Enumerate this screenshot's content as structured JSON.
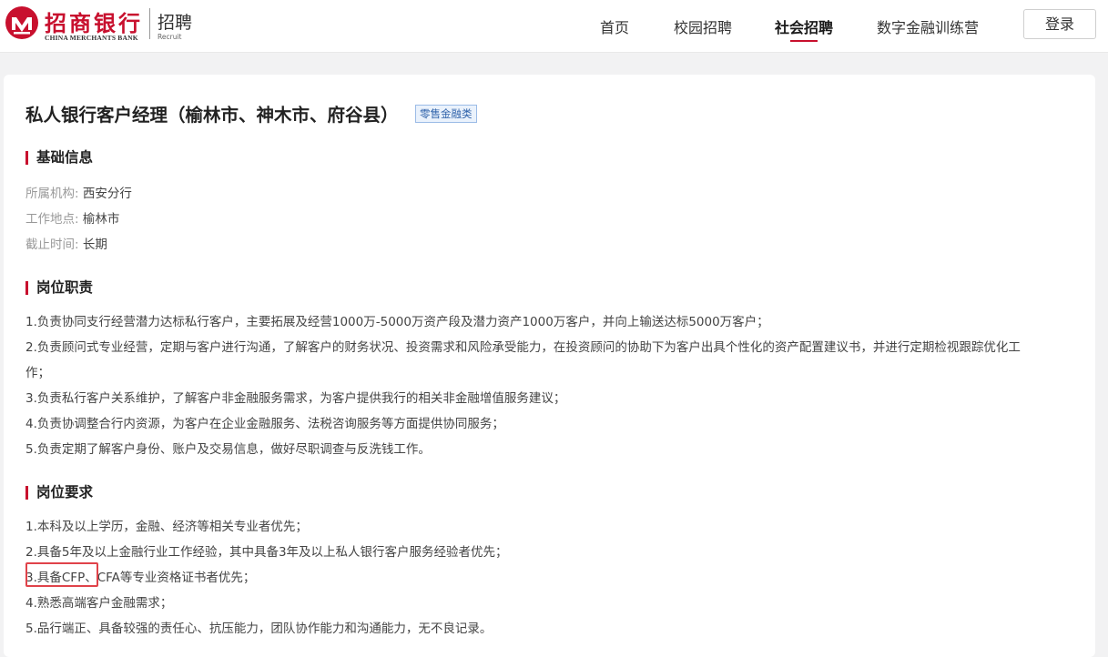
{
  "brand": {
    "name_cn": "招商银行",
    "name_en": "CHINA MERCHANTS BANK",
    "recruit_cn": "招聘",
    "recruit_en": "Recruit"
  },
  "nav": {
    "items": [
      {
        "label": "首页",
        "active": false
      },
      {
        "label": "校园招聘",
        "active": false
      },
      {
        "label": "社会招聘",
        "active": true
      },
      {
        "label": "数字金融训练营",
        "active": false
      }
    ],
    "login_label": "登录"
  },
  "job": {
    "title": "私人银行客户经理（榆林市、神木市、府谷县）",
    "tag": "零售金融类"
  },
  "basic_info": {
    "heading": "基础信息",
    "rows": [
      {
        "label": "所属机构:",
        "value": "西安分行"
      },
      {
        "label": "工作地点:",
        "value": "榆林市"
      },
      {
        "label": "截止时间:",
        "value": "长期"
      }
    ]
  },
  "duties": {
    "heading": "岗位职责",
    "lines": [
      "1.负责协同支行经营潜力达标私行客户，主要拓展及经营1000万-5000万资产段及潜力资产1000万客户，并向上输送达标5000万客户；",
      "2.负责顾问式专业经营，定期与客户进行沟通，了解客户的财务状况、投资需求和风险承受能力，在投资顾问的协助下为客户出具个性化的资产配置建议书，并进行定期检视跟踪优化工",
      "作；",
      "3.负责私行客户关系维护，了解客户非金融服务需求，为客户提供我行的相关非金融增值服务建议；",
      "4.负责协调整合行内资源，为客户在企业金融服务、法税咨询服务等方面提供协同服务；",
      "5.负责定期了解客户身份、账户及交易信息，做好尽职调查与反洗钱工作。"
    ]
  },
  "requirements": {
    "heading": "岗位要求",
    "lines": [
      "1.本科及以上学历，金融、经济等相关专业者优先；",
      "2.具备5年及以上金融行业工作经验，其中具备3年及以上私人银行客户服务经验者优先；",
      "3.具备CFP、CFA等专业资格证书者优先；",
      "4.熟悉高端客户金融需求；",
      "5.品行端正、具备较强的责任心、抗压能力，团队协作能力和沟通能力，无不良记录。"
    ]
  },
  "colors": {
    "accent": "#c8102e",
    "highlight_box": "#e0434a",
    "tag_bg": "#eaf2fc",
    "tag_text": "#2b5fa8"
  }
}
